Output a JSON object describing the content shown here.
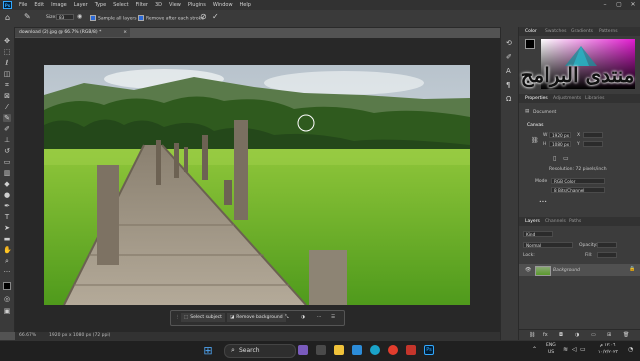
{
  "menubar": {
    "logo": "Ps",
    "items": [
      "File",
      "Edit",
      "Image",
      "Layer",
      "Type",
      "Select",
      "Filter",
      "3D",
      "View",
      "Plugins",
      "Window",
      "Help"
    ]
  },
  "options_bar": {
    "size_label": "Size:",
    "size_value": "83",
    "sample_all_layers": "Sample all layers",
    "remove_after_stroke": "Remove after each stroke"
  },
  "document": {
    "tab_title": "download (2).jpg @ 66.7% (RGB/8) *",
    "zoom": "66.67%",
    "doc_info": "1920 px x 1080 px (72 ppi)"
  },
  "context_bar": {
    "select_subject": "Select subject",
    "remove_background": "Remove background"
  },
  "panels": {
    "color_tabs": [
      "Color",
      "Swatches",
      "Gradients",
      "Patterns"
    ],
    "properties_tabs": [
      "Properties",
      "Adjustments",
      "Libraries"
    ],
    "document_label": "Document",
    "canvas_section": "Canvas",
    "width_label": "W",
    "width_value": "1920 px",
    "height_label": "H",
    "height_value": "1080 px",
    "x_label": "X",
    "y_label": "Y",
    "resolution": "Resolution: 72 pixels/inch",
    "mode_label": "Mode",
    "mode_value": "RGB Color",
    "bits_value": "8 Bits/Channel",
    "layers_tabs": [
      "Layers",
      "Channels",
      "Paths"
    ],
    "kind_label": "Kind",
    "blend_mode": "Normal",
    "opacity_label": "Opacity:",
    "lock_label": "Lock:",
    "fill_label": "Fill:",
    "layer_name": "Background"
  },
  "watermark": {
    "text": "منتدى البرامج"
  },
  "taskbar": {
    "search_placeholder": "Search",
    "lang_top": "ENG",
    "lang_bottom": "US",
    "time": "١٢:٠٦ م",
    "date": "١٠/٢/٢٠٢٣"
  }
}
